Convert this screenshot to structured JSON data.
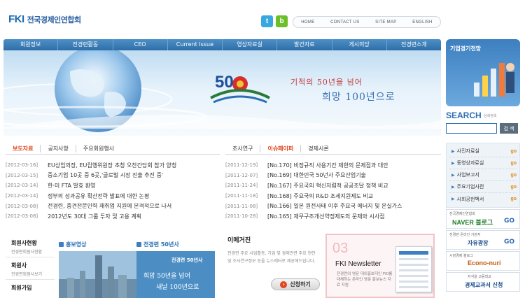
{
  "logo": {
    "mark": "FKI",
    "text": "전국경제인연합회"
  },
  "social": {
    "twitter": "t",
    "blog": "b"
  },
  "util_links": [
    "HOME",
    "CONTACT US",
    "SITE MAP",
    "ENGLISH"
  ],
  "nav": [
    "회원정보",
    "전경련활동",
    "CEO",
    "Current Issue",
    "영상자료실",
    "발간자료",
    "게시미당",
    "전경련소개"
  ],
  "banner": {
    "number": "50",
    "slogan_line1": "기적의 50년을 넘어",
    "slogan_line2": "희망 100년으로"
  },
  "sidebar": {
    "forecast_title": "기업경기전망",
    "search_label": "SEARCH",
    "search_sub": "상세검색",
    "search_button": "검 색",
    "quick_links": [
      {
        "label": "사진자료실",
        "go": "go"
      },
      {
        "label": "동영상자료실",
        "go": "go"
      },
      {
        "label": "사업보고서",
        "go": "go"
      },
      {
        "label": "주요기업사전",
        "go": "go"
      },
      {
        "label": "사회공헌백서",
        "go": "go"
      }
    ],
    "ads": [
      {
        "top": "전국경제인연합회",
        "main": "NAVER 블로그",
        "go": "GO"
      },
      {
        "top": "전경련 온라인 기관지",
        "main": "자유광장",
        "go": "GO"
      },
      {
        "top": "시장경제 블로그",
        "main": "Econo-nuri",
        "go": ""
      },
      {
        "top": "지식을 고등학교",
        "main": "경제교과서 신청",
        "go": ""
      }
    ]
  },
  "left_tabs": [
    "보도자료",
    "공지사항",
    "주요회원행사"
  ],
  "left_news": [
    {
      "date": "[2012-03-16]",
      "title": "EU상임의장, EU집행위원장 초청 오찬간담회 참가 양청"
    },
    {
      "date": "[2012-03-15]",
      "title": "중소기업 10곳 중 6곳,'글로벌 시장 진출 추진 중'"
    },
    {
      "date": "[2012-03-14]",
      "title": "한·미 FTA 발효 환영"
    },
    {
      "date": "[2012-03-14]",
      "title": "정부의 성과공유 확산전략 발표에 대한 논평"
    },
    {
      "date": "[2012-03-08]",
      "title": "전경련, 중견전문인력 재취업 지원에 본격적으로 나서"
    },
    {
      "date": "[2012-03-08]",
      "title": "2012년도 30대 그룹 투자 및 고용 계획"
    }
  ],
  "right_tabs": [
    "조사연구",
    "이슈페이퍼",
    "경제시론"
  ],
  "right_news": [
    {
      "date": "[2011-12-19]",
      "title": "[No.170] 비정규직 사용기간 제한의 문제점과 대안"
    },
    {
      "date": "[2011-12-07]",
      "title": "[No.169] 대한민국 50년사 주요산업기술"
    },
    {
      "date": "[2011-11-24]",
      "title": "[No.167] 주요국의 혁신저렴적 공공조달 정책 비교"
    },
    {
      "date": "[2011-11-18]",
      "title": "[No.168] 주요국의 R&D 조세지원제도 비교"
    },
    {
      "date": "[2011-11-08]",
      "title": "[No.166] 일본 원전사태 이후 주요국 에너지 및 온실가스"
    },
    {
      "date": "[2011-10-28]",
      "title": "[No.165] 재무구조개선약정제도의 문제와 시사점"
    }
  ],
  "members": [
    {
      "title": "회원사현황",
      "sub": "전경련회원사현황"
    },
    {
      "title": "회원사",
      "sub": "전경련회원사보기"
    },
    {
      "title": "회원가입",
      "sub": ""
    }
  ],
  "video": {
    "title": "홍보영상"
  },
  "history": {
    "title": "전경련 50년사",
    "badge": "전경련 50년사",
    "line1": "희망 50년을 넘어",
    "line2": "새날 100년으로"
  },
  "mail": {
    "title": "이메거진",
    "body": "전경련 주요 사업활동, 기업 및 경제관련 주요 현안 및 조사연구정보 등을 뉴스레터로 제공해드립니다.",
    "button": "신청하기"
  },
  "newsletter": {
    "num": "03",
    "title": "FKI Newsletter",
    "body": "전경련의 영문 대외홍보지인 FKI를 대체하는 온라인 영문 홍보뉴스 자료 지원"
  },
  "colors": {
    "brand": "#2f6ea8",
    "accent": "#e0451f",
    "go": "#e08a1a"
  }
}
